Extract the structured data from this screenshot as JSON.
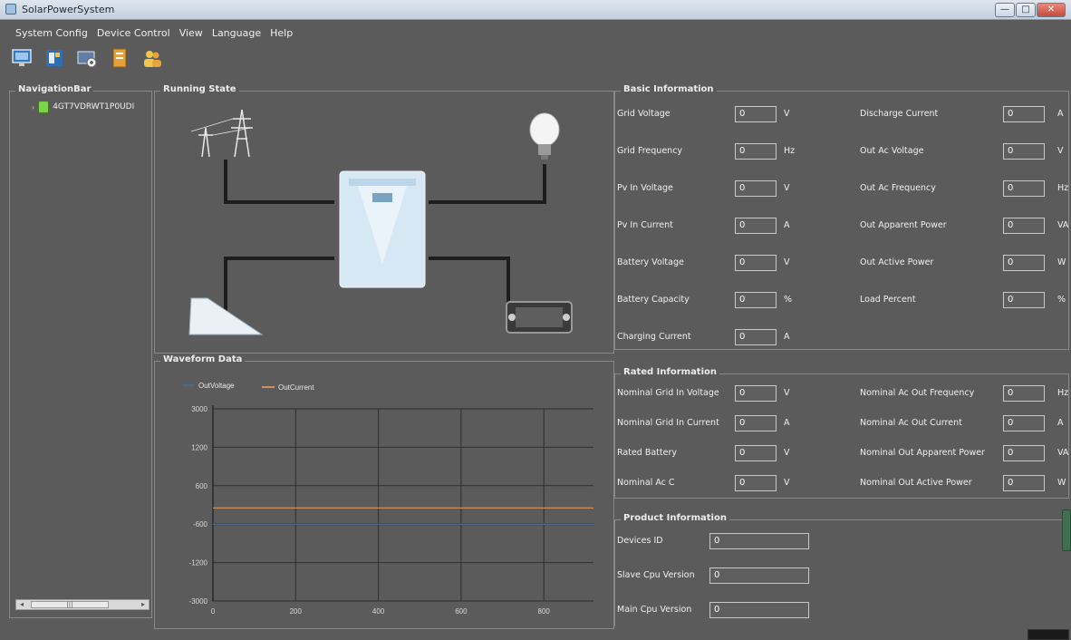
{
  "window": {
    "title": "SolarPowerSystem",
    "controls": {
      "minimize": "—",
      "maximize": "□",
      "close": "✕"
    }
  },
  "menu": [
    "System Config",
    "Device Control",
    "View",
    "Language",
    "Help"
  ],
  "toolbar": {
    "icons": [
      "monitor-icon",
      "config-icon",
      "device-icon",
      "log-icon",
      "users-icon"
    ]
  },
  "navigation": {
    "title": "NavigationBar",
    "device_id": "4GT7VDRWT1P0UDI"
  },
  "running_state": {
    "title": "Running State"
  },
  "waveform": {
    "title": "Waveform Data",
    "legend": [
      "OutVoltage",
      "OutCurrent"
    ]
  },
  "chart_data": {
    "type": "line",
    "series": [
      {
        "name": "OutVoltage",
        "color": "#4d6a85",
        "x": [
          0,
          920
        ],
        "y": [
          -600,
          -600
        ]
      },
      {
        "name": "OutCurrent",
        "color": "#c8925a",
        "x": [
          0,
          920
        ],
        "y": [
          -300,
          -300
        ]
      }
    ],
    "ylim": [
      -3000,
      3000
    ],
    "xlim": [
      0,
      920
    ],
    "ytick_labels": [
      "3000",
      "1200",
      "600",
      "-600",
      "-1200",
      "-3000"
    ],
    "xtick_labels": [
      "0",
      "200",
      "400",
      "600",
      "800"
    ],
    "grid": true
  },
  "basic_info": {
    "title": "Basic Information",
    "left": [
      {
        "label": "Grid Voltage",
        "value": "0",
        "unit": "V"
      },
      {
        "label": "Grid Frequency",
        "value": "0",
        "unit": "Hz"
      },
      {
        "label": "Pv In Voltage",
        "value": "0",
        "unit": "V"
      },
      {
        "label": "Pv In Current",
        "value": "0",
        "unit": "A"
      },
      {
        "label": "Battery Voltage",
        "value": "0",
        "unit": "V"
      },
      {
        "label": "Battery Capacity",
        "value": "0",
        "unit": "%"
      },
      {
        "label": "Charging Current",
        "value": "0",
        "unit": "A"
      }
    ],
    "right": [
      {
        "label": "Discharge Current",
        "value": "0",
        "unit": "A"
      },
      {
        "label": "Out Ac Voltage",
        "value": "0",
        "unit": "V"
      },
      {
        "label": "Out Ac Frequency",
        "value": "0",
        "unit": "Hz"
      },
      {
        "label": "Out Apparent Power",
        "value": "0",
        "unit": "VA"
      },
      {
        "label": "Out Active Power",
        "value": "0",
        "unit": "W"
      },
      {
        "label": "Load Percent",
        "value": "0",
        "unit": "%"
      }
    ]
  },
  "rated_info": {
    "title": "Rated Information",
    "left": [
      {
        "label": "Nominal Grid In Voltage",
        "value": "0",
        "unit": "V"
      },
      {
        "label": "Nominal Grid In Current",
        "value": "0",
        "unit": "A"
      },
      {
        "label": "Rated Battery",
        "value": "0",
        "unit": "V"
      },
      {
        "label": "Nominal Ac C",
        "value": "0",
        "unit": "V"
      }
    ],
    "right": [
      {
        "label": "Nominal Ac Out Frequency",
        "value": "0",
        "unit": "Hz"
      },
      {
        "label": "Nominal Ac Out Current",
        "value": "0",
        "unit": "A"
      },
      {
        "label": "Nominal Out Apparent Power",
        "value": "0",
        "unit": "VA"
      },
      {
        "label": "Nominal Out Active Power",
        "value": "0",
        "unit": "W"
      }
    ]
  },
  "product_info": {
    "title": "Product Information",
    "fields": [
      {
        "label": "Devices ID",
        "value": "0"
      },
      {
        "label": "Slave Cpu Version",
        "value": "0"
      },
      {
        "label": "Main Cpu Version",
        "value": "0"
      }
    ]
  },
  "colors": {
    "background": "#5b5b5b",
    "panel_border": "#8a8a8a",
    "titlebar": "#c3cfdd",
    "close_button": "#c44b3c"
  }
}
